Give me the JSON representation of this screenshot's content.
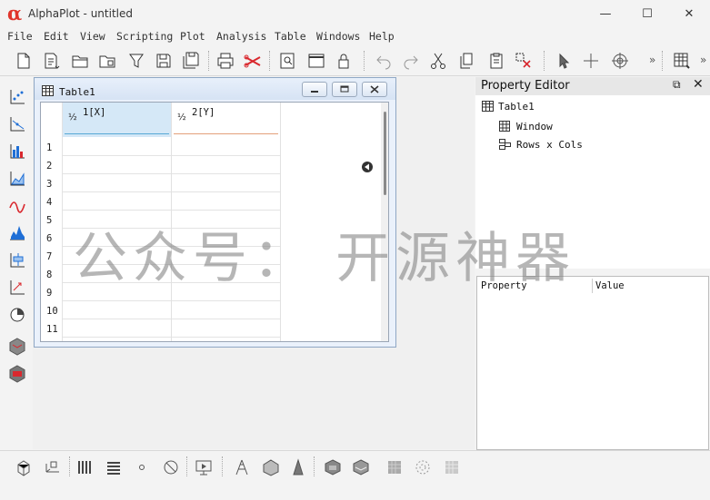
{
  "window": {
    "title": "AlphaPlot - untitled",
    "logo": "α",
    "minimize": "—",
    "maximize": "☐",
    "close": "✕"
  },
  "menu": [
    "File",
    "Edit",
    "View",
    "Scripting",
    "Plot",
    "Analysis",
    "Table",
    "Windows",
    "Help"
  ],
  "toolbar": {
    "overflow_1": "»",
    "overflow_2": "»",
    "overflow_3": "»"
  },
  "table_window": {
    "title": "Table1",
    "columns": [
      {
        "designation": "½",
        "label": "1[X]",
        "selected": true
      },
      {
        "designation": "½",
        "label": "2[Y]",
        "selected": false
      }
    ],
    "rows": [
      "1",
      "2",
      "3",
      "4",
      "5",
      "6",
      "7",
      "8",
      "9",
      "10",
      "11"
    ]
  },
  "property_editor": {
    "title": "Property Editor",
    "float_icon": "⧉",
    "close_icon": "✕",
    "tree": {
      "root": "Table1",
      "children": [
        "Window",
        "Rows x Cols"
      ]
    },
    "table_headers": {
      "property": "Property",
      "value": "Value"
    }
  },
  "watermark": "公众号： 开源神器",
  "colors": {
    "accent": "#e0362c",
    "selected_column": "#d5e8f7",
    "x_underline": "#57a8d6",
    "y_underline": "#e3a07a"
  }
}
